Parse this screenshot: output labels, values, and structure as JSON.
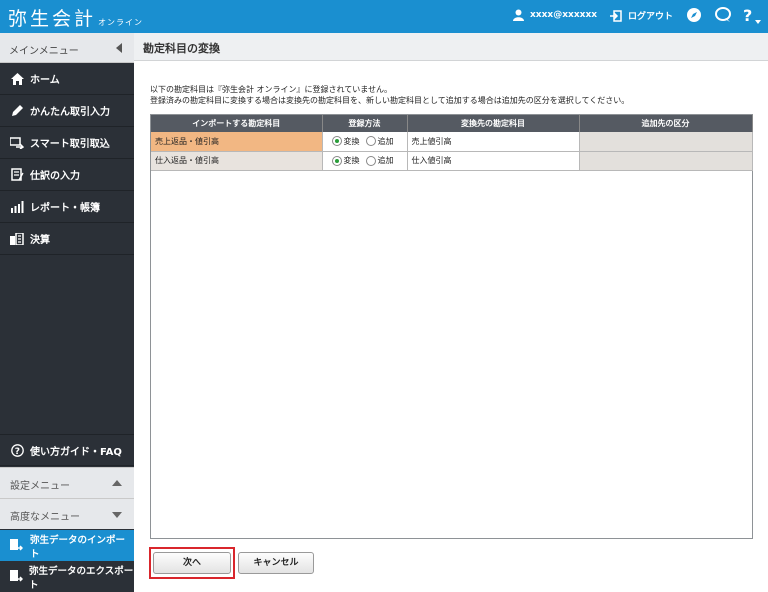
{
  "app": {
    "logo": "弥生会計",
    "logo_sub": "オンライン",
    "user": "xxxx@xxxxxx",
    "logout": "ログアウト"
  },
  "sidebar": {
    "menu_header": "メインメニュー",
    "items": [
      {
        "label": "ホーム",
        "icon": "home-icon"
      },
      {
        "label": "かんたん取引入力",
        "icon": "pencil-icon"
      },
      {
        "label": "スマート取引取込",
        "icon": "import-card-icon"
      },
      {
        "label": "仕訳の入力",
        "icon": "journal-icon"
      },
      {
        "label": "レポート・帳簿",
        "icon": "report-chart-icon"
      },
      {
        "label": "決算",
        "icon": "settlement-icon"
      }
    ],
    "guide": "使い方ガイド・FAQ",
    "settings_menu": "設定メニュー",
    "advanced_menu": "高度なメニュー",
    "import": "弥生データのインポート",
    "export": "弥生データのエクスポート"
  },
  "main": {
    "title": "勘定科目の変換",
    "desc_line1": "以下の勘定科目は『弥生会計 オンライン』に登録されていません。",
    "desc_line2": "登録済みの勘定科目に変換する場合は変換先の勘定科目を、新しい勘定科目として追加する場合は追加先の区分を選択してください。",
    "table": {
      "headers": [
        "インポートする勘定科目",
        "登録方法",
        "変換先の勘定科目",
        "追加先の区分"
      ],
      "rows": [
        {
          "source": "売上返品・値引高",
          "method_convert": "変換",
          "method_add": "追加",
          "target": "売上値引高",
          "category": ""
        },
        {
          "source": "仕入返品・値引高",
          "method_convert": "変換",
          "method_add": "追加",
          "target": "仕入値引高",
          "category": ""
        }
      ]
    },
    "next_button": "次へ",
    "cancel_button": "キャンセル"
  },
  "colors": {
    "brand_blue": "#1a8fd0",
    "sidebar_dark": "#2b3037",
    "highlight_row": "#f2b783",
    "focus_red": "#d9262c"
  }
}
